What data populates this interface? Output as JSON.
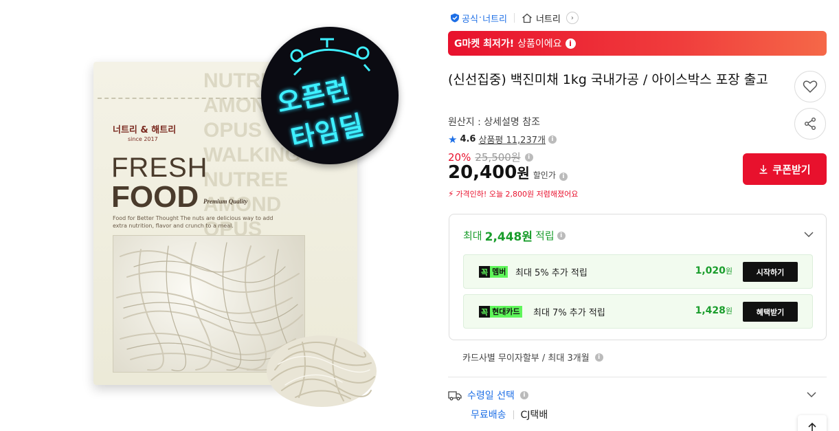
{
  "product_image": {
    "badge_line1": "오픈런",
    "badge_line2": "타임딜",
    "bag_brand": "너트리 & 해트리",
    "bag_since": "since 2017",
    "bag_fresh": "FRESH",
    "bag_food": "FOOD",
    "bag_premium": "Premium Quality",
    "bag_desc": "Food for Better Thought The nuts are delicious way to add extra nutrition, flavor and crunch to a meal.",
    "bag_bg_words": "NUTREE\nAMOND\nOPUS\nWALKING\nNUTREE\nAMOND\nOPUS\nNUTREE\nAMOND\nOPUS\nHAZEL"
  },
  "seller": {
    "official_label": "공식",
    "dot": "·",
    "seller_name": "너트리",
    "store_name": "너트리"
  },
  "banner": {
    "brand": "G마켓 최저가!",
    "text": "상품이에요",
    "info_icon": "i"
  },
  "product": {
    "title": "(신선집중) 백진미채 1kg 국내가공 / 아이스박스 포장 출고",
    "origin": "원산지 : 상세설명 참조",
    "rating_score": "4.6",
    "review_label": "상품평 11,237개",
    "discount": "20%",
    "original_price": "25,500원",
    "price": "20,400",
    "price_unit": "원",
    "sale_label": "할인가",
    "price_drop_note": "가격인하! 오늘 2,800원 저렴해졌어요",
    "coupon_button": "쿠폰받기"
  },
  "rewards": {
    "headline_prefix": "최대",
    "headline_amount": "2,448원",
    "headline_suffix": "적립",
    "items": [
      {
        "tag_k": "꼭",
        "tag_name": "멤버",
        "label": "최대 5% 추가 적립",
        "amount": "1,020",
        "unit": "원",
        "button": "시작하기"
      },
      {
        "tag_k": "꼭",
        "tag_name": "현대카드",
        "label": "최대 7% 추가 적립",
        "amount": "1,428",
        "unit": "원",
        "button": "혜택받기"
      }
    ]
  },
  "installment": "카드사별 무이자할부 / 최대 3개월",
  "delivery": {
    "label": "수령일 선택",
    "free_shipping": "무료배송",
    "carrier": "CJ택배"
  },
  "colors": {
    "accent_red": "#e8112d",
    "accent_blue": "#1e6fe6",
    "reward_green": "#1a9d2c",
    "badge_cyan": "#3ef0ff"
  },
  "icons": [
    "shield-check-icon",
    "home-icon",
    "chevron-right-icon",
    "info-icon",
    "heart-icon",
    "share-icon",
    "star-icon",
    "download-icon",
    "chevron-down-icon",
    "truck-icon",
    "arrow-up-icon",
    "alarm-clock-icon",
    "lightning-icon"
  ]
}
